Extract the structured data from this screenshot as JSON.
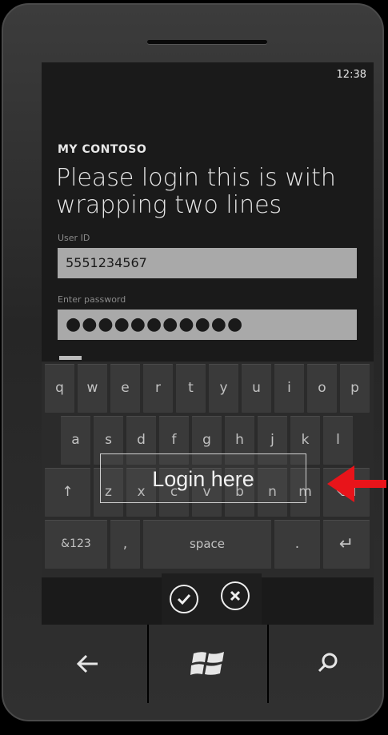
{
  "status_bar": {
    "time": "12:38"
  },
  "app": {
    "name": "MY CONTOSO",
    "title": "Please login this is with wrapping two lines"
  },
  "form": {
    "user_id_label": "User ID",
    "user_id_value": "5551234567",
    "password_label": "Enter password",
    "password_value": "●●●●●●●●●●●"
  },
  "keyboard": {
    "row1": [
      "q",
      "w",
      "e",
      "r",
      "t",
      "y",
      "u",
      "i",
      "o",
      "p"
    ],
    "row2": [
      "a",
      "s",
      "d",
      "f",
      "g",
      "h",
      "j",
      "k",
      "l"
    ],
    "row3": [
      "z",
      "x",
      "c",
      "v",
      "b",
      "n",
      "m"
    ],
    "shift": "↑",
    "backspace": "⌫",
    "symbols": "&123",
    "comma": ",",
    "space": "space",
    "period": ".",
    "enter": "↵"
  },
  "app_bar": {
    "accept_icon": "check-icon",
    "cancel_icon": "close-icon"
  },
  "hardware": {
    "back_icon": "back-arrow-icon",
    "start_icon": "windows-logo-icon",
    "search_icon": "search-icon"
  },
  "annotation": {
    "callout": "Login here",
    "arrow_color": "#e8141a"
  }
}
